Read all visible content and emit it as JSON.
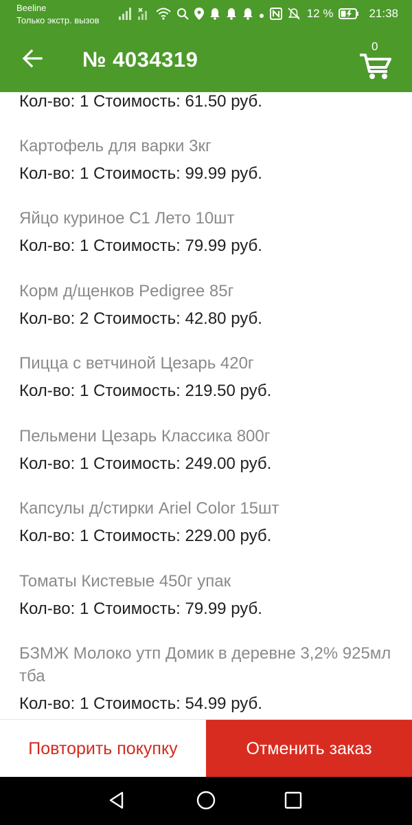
{
  "status_bar": {
    "carrier": "Beeline",
    "carrier_status": "Только экстр. вызов",
    "battery": "12 %",
    "time": "21:38",
    "icons": [
      "signal-icon",
      "no-signal-icon",
      "wifi-icon",
      "search-icon",
      "location-icon",
      "notification-bell-icon",
      "notification-bell-icon",
      "notification-bell-icon",
      "dot-icon",
      "nfc-icon",
      "mute-icon",
      "battery-icon"
    ]
  },
  "header": {
    "title": "№ 4034319",
    "cart_count": "0",
    "back_icon": "arrow-left-icon",
    "cart_icon": "cart-icon"
  },
  "items": [
    {
      "name": "",
      "qty_label": "Кол-во: 1 Стоимость: 61.50 руб."
    },
    {
      "name": "Картофель для варки 3кг",
      "qty_label": "Кол-во: 1 Стоимость: 99.99 руб."
    },
    {
      "name": "Яйцо куриное С1 Лето 10шт",
      "qty_label": "Кол-во: 1 Стоимость: 79.99 руб."
    },
    {
      "name": "Корм д/щенков Pedigree 85г",
      "qty_label": "Кол-во: 2 Стоимость: 42.80 руб."
    },
    {
      "name": "Пицца с ветчиной Цезарь 420г",
      "qty_label": "Кол-во: 1 Стоимость: 219.50 руб."
    },
    {
      "name": "Пельмени Цезарь Классика 800г",
      "qty_label": "Кол-во: 1 Стоимость: 249.00 руб."
    },
    {
      "name": "Капсулы д/стирки Ariel Color 15шт",
      "qty_label": "Кол-во: 1 Стоимость: 229.00 руб."
    },
    {
      "name": "Томаты Кистевые 450г упак",
      "qty_label": "Кол-во: 1 Стоимость: 79.99 руб."
    },
    {
      "name": "БЗМЖ Молоко утп Домик в деревне 3,2% 925мл тба",
      "qty_label": "Кол-во: 1 Стоимость: 54.99 руб."
    }
  ],
  "actions": {
    "repeat_label": "Повторить покупку",
    "cancel_label": "Отменить заказ"
  },
  "colors": {
    "header": "#4c9a2a",
    "cancel_button": "#d92c20",
    "repeat_text": "#d32a1f"
  },
  "nav": {
    "back": "nav-back-icon",
    "home": "nav-home-icon",
    "recents": "nav-recents-icon"
  }
}
